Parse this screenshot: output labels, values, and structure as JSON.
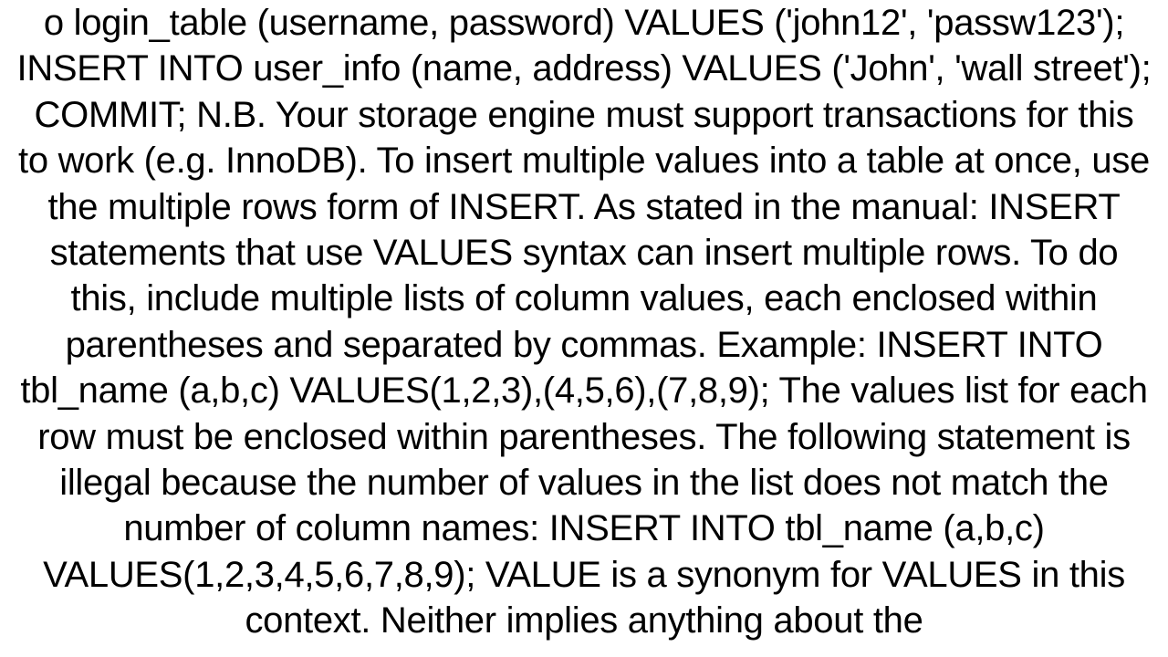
{
  "document": {
    "text": "o login_table (username, password) VALUES ('john12', 'passw123'); INSERT INTO user_info (name, address) VALUES ('John', 'wall street'); COMMIT;  N.B. Your storage engine must support transactions for this to work (e.g. InnoDB). To insert multiple values into a table at once, use the multiple rows form of INSERT.  As stated in the manual: INSERT statements that use VALUES syntax can insert multiple rows. To do this, include multiple lists of column values, each enclosed within parentheses and separated by commas. Example: INSERT INTO tbl_name (a,b,c) VALUES(1,2,3),(4,5,6),(7,8,9); The values list for each row must be enclosed within parentheses. The following statement is illegal because the number of values in the list does not match the number of column names: INSERT INTO tbl_name (a,b,c) VALUES(1,2,3,4,5,6,7,8,9); VALUE is a synonym for VALUES in this context. Neither implies anything about the"
  }
}
